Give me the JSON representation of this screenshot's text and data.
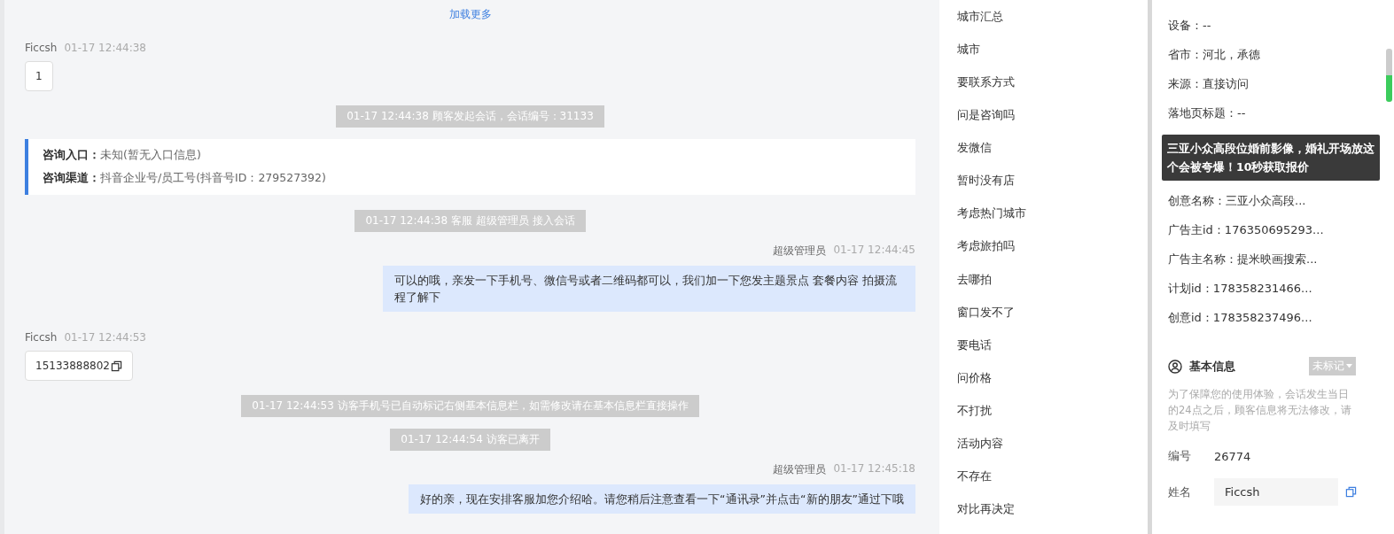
{
  "chat": {
    "load_more": "加载更多",
    "messages": [
      {
        "kind": "customer",
        "sender": "Ficcsh",
        "time": "01-17 12:44:38",
        "text": "1",
        "copyable": false
      },
      {
        "kind": "notice",
        "text": "01-17 12:44:38 顾客发起会话，会话编号：31133"
      },
      {
        "kind": "source",
        "rows": [
          {
            "label": "咨询入口：",
            "value": "未知(暂无入口信息)"
          },
          {
            "label": "咨询渠道：",
            "value": "抖音企业号/员工号(抖音号ID：279527392)"
          }
        ]
      },
      {
        "kind": "notice",
        "text": "01-17 12:44:38 客服 超级管理员 接入会话"
      },
      {
        "kind": "agent",
        "sender": "超级管理员",
        "time": "01-17 12:44:45",
        "text": "可以的哦，亲发一下手机号、微信号或者二维码都可以，我们加一下您发主题景点 套餐内容 拍摄流程了解下"
      },
      {
        "kind": "customer",
        "sender": "Ficcsh",
        "time": "01-17 12:44:53",
        "text": "15133888802",
        "copyable": true
      },
      {
        "kind": "notice",
        "text": "01-17 12:44:53 访客手机号已自动标记右侧基本信息栏，如需修改请在基本信息栏直接操作"
      },
      {
        "kind": "notice",
        "text": "01-17 12:44:54 访客已离开"
      },
      {
        "kind": "agent",
        "sender": "超级管理员",
        "time": "01-17 12:45:18",
        "text": "好的亲，现在安排客服加您介绍哈。请您稍后注意查看一下“通讯录”并点击“新的朋友”通过下哦"
      }
    ]
  },
  "quick_replies": [
    "城市汇总",
    "城市",
    "要联系方式",
    "问是咨询吗",
    "发微信",
    "暂时没有店",
    "考虑热门城市",
    "考虑旅拍吗",
    "去哪拍",
    "窗口发不了",
    "要电话",
    "问价格",
    "不打扰",
    "活动内容",
    "不存在",
    "对比再决定"
  ],
  "visitor_info": {
    "rows_before": [
      "设备：--",
      "省市：河北，承德",
      "来源：直接访问",
      "落地页标题：--"
    ],
    "rows_after": [
      "创意名称：三亚小众高段...",
      "广告主id：176350695293...",
      "广告主名称：提米映画搜索...",
      "计划id：178358231466...",
      "创意id：178358237496..."
    ],
    "tooltip": "三亚小众高段位婚前影像，婚礼开场放这个会被夸爆！10秒获取报价"
  },
  "basic_info": {
    "title": "基本信息",
    "tag": "未标记",
    "note": "为了保障您的使用体验，会话发生当日的24点之后，顾客信息将无法修改，请及时填写",
    "fields": [
      {
        "kind": "text",
        "label": "编号",
        "value": "26774"
      },
      {
        "kind": "input",
        "label": "姓名",
        "value": "Ficcsh"
      }
    ]
  }
}
